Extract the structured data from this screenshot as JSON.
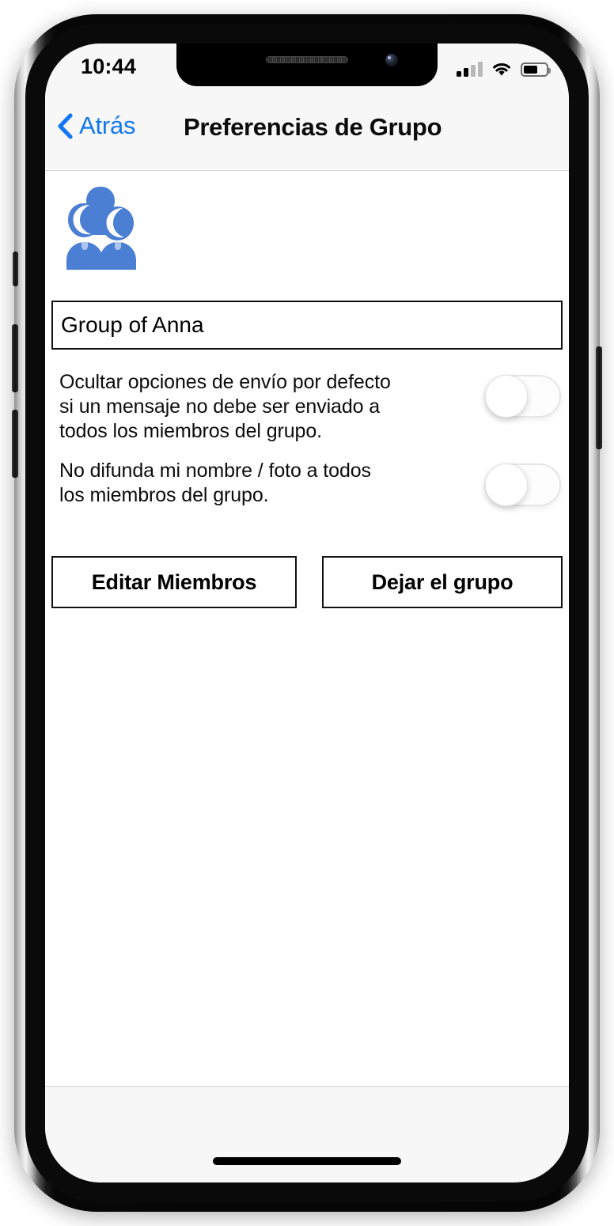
{
  "status_bar": {
    "time": "10:44",
    "signal_icon": "cellular-signal-icon",
    "signal_bars_active": 2,
    "signal_bars_total": 4,
    "wifi_icon": "wifi-icon",
    "battery_icon": "battery-icon",
    "battery_level_percent": 55
  },
  "nav_bar": {
    "back_icon": "chevron-left-icon",
    "back_label": "Atrás",
    "title": "Preferencias de Grupo",
    "accent_color": "#1277f0"
  },
  "content": {
    "group_avatar_icon": "group-people-icon",
    "group_avatar_color": "#4a7fd4",
    "group_name": {
      "value": "Group of Anna",
      "placeholder": "Group of Anna"
    },
    "preferences": [
      {
        "label": "Ocultar opciones de envío por defecto si un mensaje no debe ser enviado a todos los miembros del grupo.",
        "toggle_state": "off"
      },
      {
        "label": "No difunda mi nombre / foto a todos los miembros del grupo.",
        "toggle_state": "off"
      }
    ],
    "actions": {
      "edit_members_label": "Editar Miembros",
      "leave_group_label": "Dejar el grupo"
    }
  },
  "footer": {
    "home_indicator": "home-indicator"
  }
}
